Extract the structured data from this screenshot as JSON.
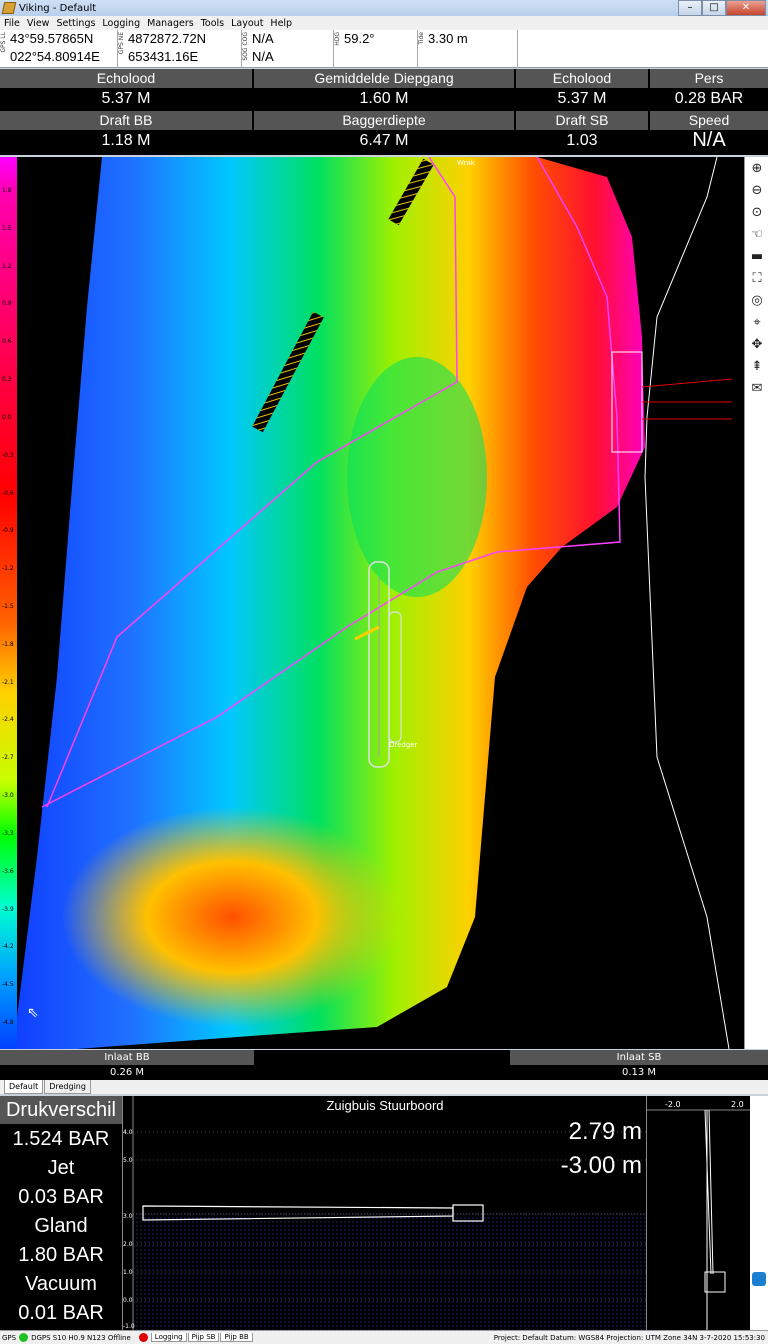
{
  "window": {
    "title": "Viking - Default"
  },
  "menu": [
    "File",
    "View",
    "Settings",
    "Logging",
    "Managers",
    "Tools",
    "Layout",
    "Help"
  ],
  "gps": {
    "lat": "43°59.57865N",
    "lon": "022°54.80914E",
    "north": "4872872.72N",
    "east": "653431.16E",
    "sog": "N/A",
    "cog": "N/A",
    "hdg": "59.2°",
    "tide": "3.30 m",
    "labels": {
      "ll": "GPS LL",
      "ne": "GPS NE",
      "sogcog": "SOG COG",
      "hdg": "HDG",
      "tide": "Tide"
    }
  },
  "panels": [
    {
      "label": "Echolood",
      "value": "5.37 M"
    },
    {
      "label": "Gemiddelde Diepgang",
      "value": "1.60 M"
    },
    {
      "label": "Echolood",
      "value": "5.37 M"
    },
    {
      "label": "Pers",
      "value": "0.28 BAR"
    },
    {
      "label": "Draft BB",
      "value": "1.18 M"
    },
    {
      "label": "Baggerdiepte",
      "value": "6.47 M"
    },
    {
      "label": "Draft SB",
      "value": "1.03"
    },
    {
      "label": "Speed",
      "value": "N/A"
    }
  ],
  "legend": [
    "1.8",
    "1.5",
    "1.2",
    "0.9",
    "0.6",
    "0.3",
    "0.0",
    "-0.3",
    "-0.6",
    "-0.9",
    "-1.2",
    "-1.5",
    "-1.8",
    "-2.1",
    "-2.4",
    "-2.7",
    "-3.0",
    "-3.3",
    "-3.6",
    "-3.9",
    "-4.2",
    "-4.5",
    "-4.8"
  ],
  "map": {
    "ship_label": "Dredger",
    "wreck_label": "Wrak"
  },
  "tools": [
    "zoom-in",
    "zoom-out",
    "zoom-fit",
    "pan",
    "ruler",
    "select",
    "target",
    "crosshair",
    "move",
    "north",
    "message"
  ],
  "inlet": [
    {
      "label": "Inlaat BB",
      "value": "0.26 M"
    },
    {
      "label": "Inlaat SB",
      "value": "0.13 M"
    }
  ],
  "tabs": [
    "Default",
    "Dredging"
  ],
  "readouts": [
    {
      "label": "Drukverschil",
      "value": "1.524 BAR"
    },
    {
      "label": "Jet",
      "value": "0.03 BAR"
    },
    {
      "label": "Gland",
      "value": "1.80 BAR"
    },
    {
      "label": "Vacuum",
      "value": "0.01 BAR"
    }
  ],
  "graph": {
    "title": "Zuigbuis Stuurboord",
    "value1": "2.79 m",
    "value2": "-3.00 m",
    "yticks": [
      "4.0",
      "5.0",
      "3.0",
      "2.0",
      "1.0",
      "0.0",
      "-1.0"
    ],
    "side_labels": [
      "-2.0",
      "2.0"
    ]
  },
  "status": {
    "gps": "GPS",
    "text": "DGPS S10 H0.9 N123 Offline",
    "tabs": [
      "Logging",
      "Pijp SB",
      "Pijp BB"
    ],
    "right": "Project: Default  Datum: WGS84  Projection: UTM Zone 34N  3-7-2020 15:53:30"
  }
}
